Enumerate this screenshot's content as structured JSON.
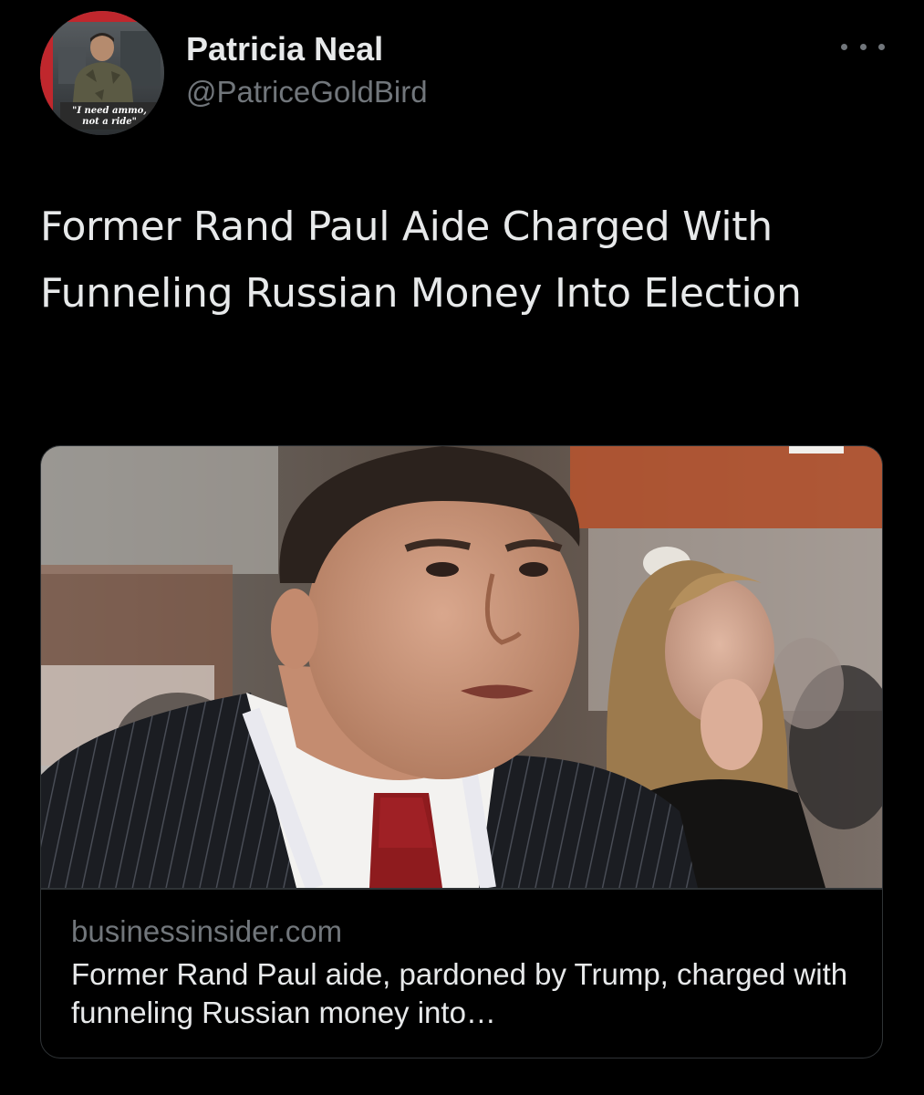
{
  "author": {
    "display_name": "Patricia Neal",
    "handle": "@PatriceGoldBird",
    "avatar_caption_line1": "\"I need ammo,",
    "avatar_caption_line2": "not a ride\""
  },
  "tweet": {
    "text": "Former Rand Paul Aide Charged With Funneling Russian Money Into Election",
    "more_icon": "more-horizontal-icon"
  },
  "link_card": {
    "domain": "businessinsider.com",
    "title": "Former Rand Paul aide, pardoned by Trump, charged with funneling Russian money into…"
  },
  "colors": {
    "background": "#000000",
    "primary_text": "#e7e9ea",
    "secondary_text": "#71767b",
    "border": "#2f3336"
  }
}
